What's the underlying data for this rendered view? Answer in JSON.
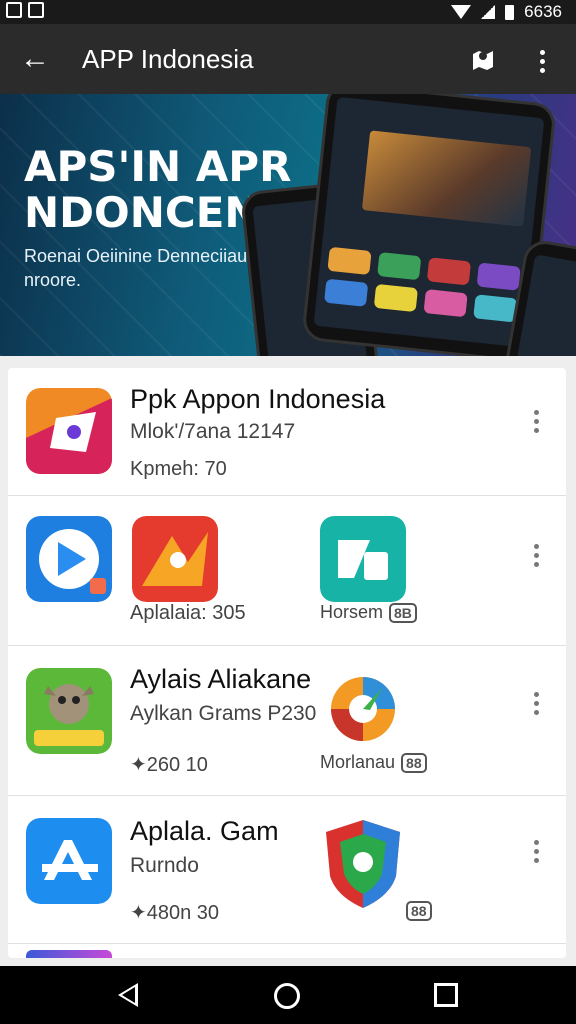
{
  "status_bar": {
    "time": "6636",
    "icons": [
      "sim-icon",
      "gallery-icon",
      "wifi-icon",
      "signal-icon",
      "battery-icon"
    ]
  },
  "app_bar": {
    "title": "APP Indonesia",
    "back_icon": "arrow-left-icon",
    "map_icon": "map-pin-icon",
    "more_icon": "more-vert-icon"
  },
  "banner": {
    "title": "APS'IN APR\nNDONCENIA",
    "subtitle": "Roenai Oeiinine Denneciiaus nroore."
  },
  "rows": [
    {
      "title": "Ppk Appon Indonesia",
      "subtitle": "Mlok'/7ana 12147",
      "meta": "Kpmeh: 70"
    },
    {
      "left_label": "Aplalaia: 305",
      "right_label": "Horsem",
      "right_badge": "8B"
    },
    {
      "title": "Aylais Aliakane",
      "subtitle": "Aylkan Grams P230",
      "meta": "✦260 10",
      "right_label": "Morlanau",
      "right_badge": "88"
    },
    {
      "title": "Aplala. Gam",
      "subtitle": "Rurndo",
      "meta": "✦480n 30",
      "right_badge": "88"
    }
  ],
  "colors": {
    "app_bar": "#2b2b2b",
    "status_bar": "#1a1a1a",
    "list_bg": "#ffffff",
    "nav_bar": "#000000"
  }
}
